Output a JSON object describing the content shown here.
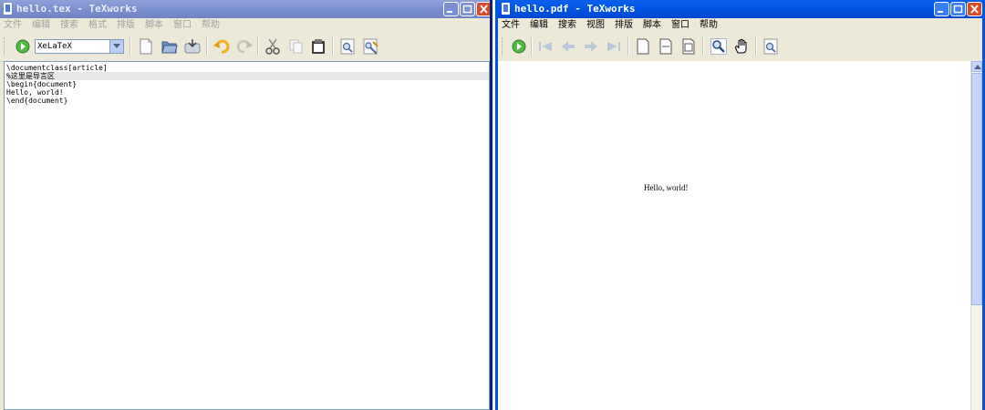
{
  "left_window": {
    "title": "hello.tex - TeXworks",
    "menu": [
      "文件",
      "编辑",
      "搜索",
      "格式",
      "排版",
      "脚本",
      "窗口",
      "帮助"
    ],
    "engine": "XeLaTeX",
    "editor_lines": [
      "\\documentclass[article]",
      "%这里是导言区",
      "\\begin{document}",
      "Hello, world!",
      "\\end{document}"
    ],
    "toolbar_icons": [
      "typeset-icon",
      "new-file-icon",
      "open-folder-icon",
      "save-icon",
      "undo-icon",
      "redo-icon",
      "cut-icon",
      "copy-icon",
      "paste-icon",
      "find-icon",
      "replace-icon"
    ]
  },
  "right_window": {
    "title": "hello.pdf - TeXworks",
    "menu": [
      "文件",
      "编辑",
      "搜索",
      "视图",
      "排版",
      "脚本",
      "窗口",
      "帮助"
    ],
    "pdf_text": "Hello, world!",
    "toolbar_icons": [
      "typeset-icon",
      "first-page-icon",
      "prev-page-icon",
      "next-page-icon",
      "last-page-icon",
      "actual-size-icon",
      "fit-width-icon",
      "fit-window-icon",
      "magnify-icon",
      "hand-icon",
      "find-icon"
    ]
  },
  "colors": {
    "active_title": "#0058e6",
    "inactive_title": "#7b8fcf",
    "window_bg": "#ece9d8",
    "close_button": "#d94a2a"
  }
}
